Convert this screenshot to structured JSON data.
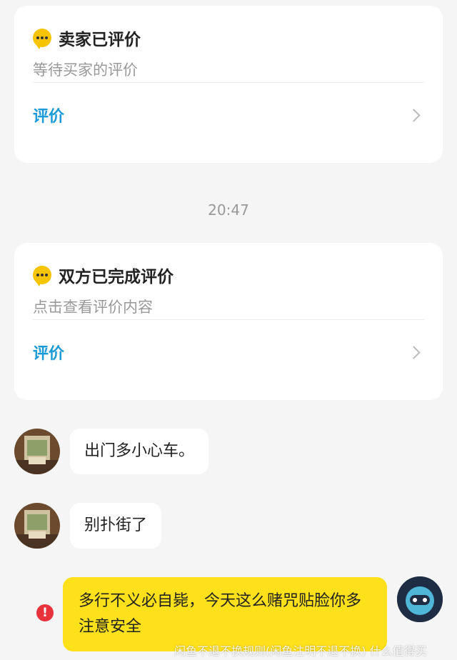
{
  "cards": [
    {
      "title": "卖家已评价",
      "subtitle": "等待买家的评价",
      "action": "评价",
      "icon": "chat-bubble-icon"
    },
    {
      "title": "双方已完成评价",
      "subtitle": "点击查看评价内容",
      "action": "评价",
      "icon": "chat-bubble-icon"
    }
  ],
  "timestamp": "20:47",
  "messages": [
    {
      "side": "incoming",
      "text": "出门多小心车。"
    },
    {
      "side": "incoming",
      "text": "别扑街了"
    },
    {
      "side": "outgoing",
      "text": "多行不义必自毙，今天这么赌咒贴脸你多注意安全",
      "status": "send-failed"
    }
  ],
  "error_icon_glyph": "!",
  "watermark": "闲鱼不退不换规则(闲鱼注明不退不换) 什么值得买",
  "colors": {
    "accent": "#1a9bd7",
    "bubble_out": "#ffe11b",
    "error": "#e8323c",
    "icon_yellow": "#f6c400"
  }
}
